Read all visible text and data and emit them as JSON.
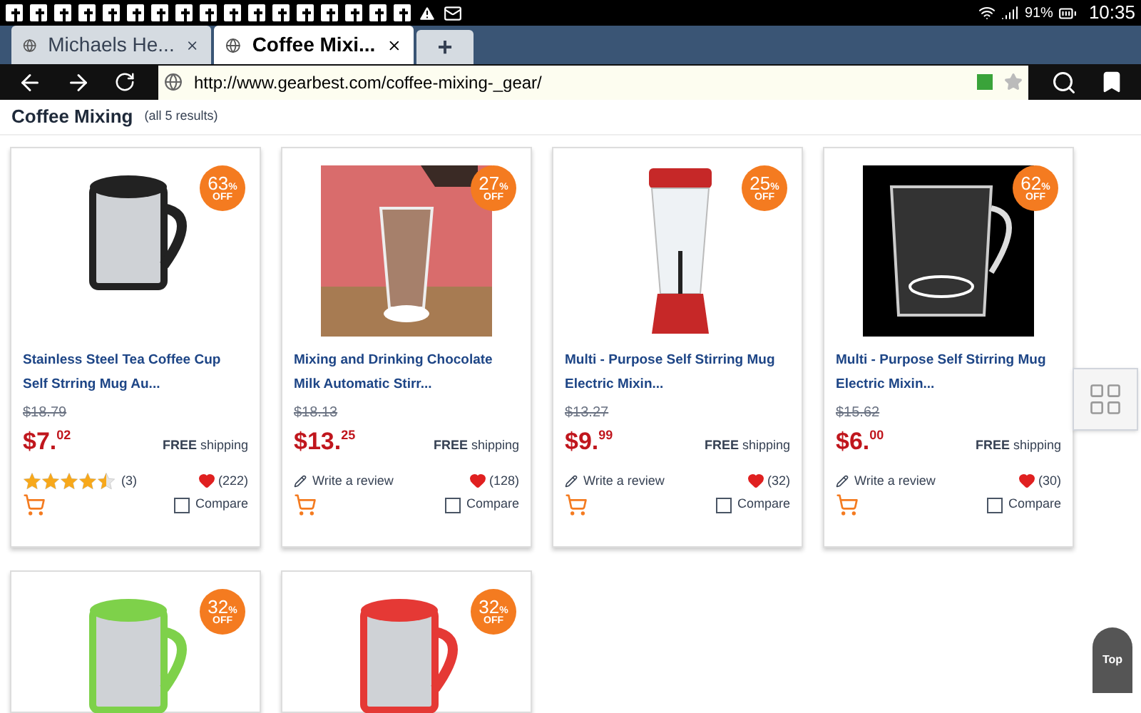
{
  "status_bar": {
    "battery": "91%",
    "time": "10:35"
  },
  "tabs": [
    {
      "label": "Michaels He...",
      "selected": false
    },
    {
      "label": "Coffee Mixi...",
      "selected": true
    }
  ],
  "new_tab": "+",
  "address_bar": {
    "url": "http://www.gearbest.com/coffee-mixing-_gear/"
  },
  "heading": {
    "title": "Coffee Mixing",
    "count": "(all 5 results)"
  },
  "products": [
    {
      "photo": {
        "kind": "mugs"
      },
      "discount": "63",
      "unit": "%",
      "off": "OFF",
      "title": "Stainless Steel Tea Coffee Cup Self Strring Mug Au...",
      "old_price": "$18.79",
      "price": "$7.$^{02}$",
      "shipping": "**FREE** shipping",
      "kind": "stars",
      "stars": 4.5,
      "reviews": "(3)",
      "likes": "(222)",
      "compare": "Compare",
      "compared": false
    },
    {
      "photo": {
        "kind": "milk"
      },
      "discount": "27",
      "unit": "%",
      "off": "OFF",
      "title": "Mixing and Drinking Chocolate Milk Automatic Stirr...",
      "old_price": "$18.13",
      "price": "$13.$^{25}$",
      "shipping": "**FREE** shipping",
      "kind": "review",
      "review": "Write a review",
      "likes": "(128)",
      "compare": "Compare",
      "compared": false
    },
    {
      "photo": {
        "kind": "bottle"
      },
      "discount": "25",
      "unit": "%",
      "off": "OFF",
      "title": "Multi - Purpose Self Stirring Mug Electric Mixin...",
      "old_price": "$13.27",
      "price": "$9.$^{99}$",
      "shipping": "**FREE** shipping",
      "kind": "review",
      "review": "Write a review",
      "likes": "(32)",
      "compare": "Compare",
      "compared": false
    },
    {
      "photo": {
        "kind": "dark"
      },
      "discount": "62",
      "unit": "%",
      "off": "OFF",
      "title": "Multi - Purpose Self Stirring Mug Electric Mixin...",
      "old_price": "$15.62",
      "price": "$6.$^{00}$",
      "shipping": "**FREE** shipping",
      "kind": "review",
      "review": "Write a review",
      "likes": "(30)",
      "compare": "Compare",
      "compared": false
    },
    {
      "photo": {
        "kind": "green"
      },
      "discount": "32",
      "unit": "%",
      "off": "OFF"
    },
    {
      "photo": {
        "kind": "red"
      },
      "discount": "32",
      "unit": "%",
      "off": "OFF"
    }
  ],
  "back_to_top": "Top"
}
